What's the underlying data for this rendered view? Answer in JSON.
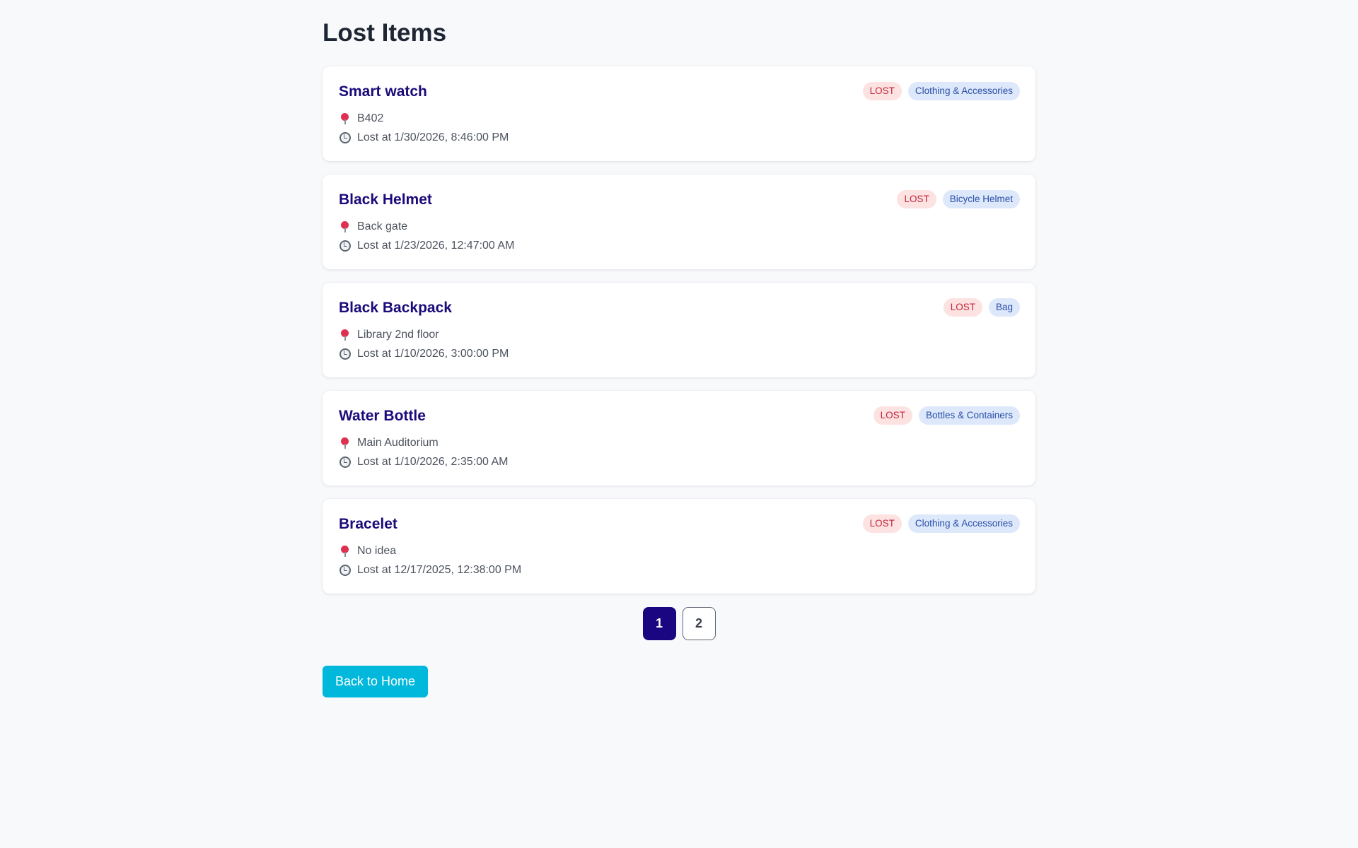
{
  "page": {
    "title": "Lost Items"
  },
  "items": [
    {
      "title": "Smart watch",
      "status": "LOST",
      "category": "Clothing & Accessories",
      "location": "B402",
      "time": "Lost at 1/30/2026, 8:46:00 PM"
    },
    {
      "title": "Black Helmet",
      "status": "LOST",
      "category": "Bicycle Helmet",
      "location": "Back gate",
      "time": "Lost at 1/23/2026, 12:47:00 AM"
    },
    {
      "title": "Black Backpack",
      "status": "LOST",
      "category": "Bag",
      "location": "Library 2nd floor",
      "time": "Lost at 1/10/2026, 3:00:00 PM"
    },
    {
      "title": "Water Bottle",
      "status": "LOST",
      "category": "Bottles & Containers",
      "location": "Main Auditorium",
      "time": "Lost at 1/10/2026, 2:35:00 AM"
    },
    {
      "title": "Bracelet",
      "status": "LOST",
      "category": "Clothing & Accessories",
      "location": "No idea",
      "time": "Lost at 12/17/2025, 12:38:00 PM"
    }
  ],
  "pagination": {
    "pages": [
      "1",
      "2"
    ],
    "current": "1"
  },
  "actions": {
    "back_home_label": "Back to Home"
  },
  "icons": {
    "location": "pin-icon",
    "time": "clock-icon"
  },
  "colors": {
    "accent": "#1a0680",
    "title": "#1a0a7a",
    "home_button": "#00b8db",
    "status_badge_bg": "#fde2e2",
    "status_badge_text": "#c0243a",
    "category_badge_bg": "#dde8fb",
    "category_badge_text": "#2a4fa8"
  }
}
